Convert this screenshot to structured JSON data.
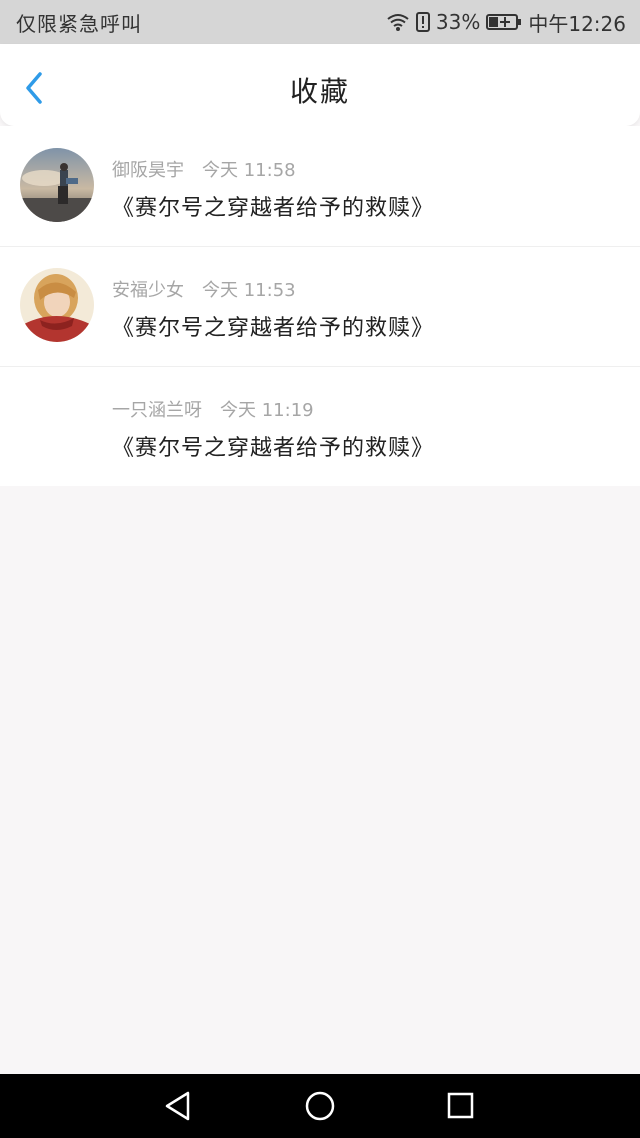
{
  "status_bar": {
    "carrier": "仅限紧急呼叫",
    "battery_percent": "33%",
    "time": "中午12:26",
    "icons": [
      "wifi-icon",
      "alert-icon",
      "battery-charging-icon"
    ]
  },
  "header": {
    "title": "收藏",
    "back_icon": "chevron-left-icon",
    "accent_color": "#2f9be8"
  },
  "favorites": [
    {
      "author": "御阪昊宇",
      "time": "今天 11:58",
      "title": "《赛尔号之穿越者给予的救赎》",
      "has_avatar": true
    },
    {
      "author": "安福少女",
      "time": "今天 11:53",
      "title": "《赛尔号之穿越者给予的救赎》",
      "has_avatar": true
    },
    {
      "author": "一只涵兰呀",
      "time": "今天 11:19",
      "title": "《赛尔号之穿越者给予的救赎》",
      "has_avatar": false
    }
  ],
  "nav_bar": {
    "buttons": [
      "back-triangle-icon",
      "home-circle-icon",
      "recent-square-icon"
    ]
  }
}
